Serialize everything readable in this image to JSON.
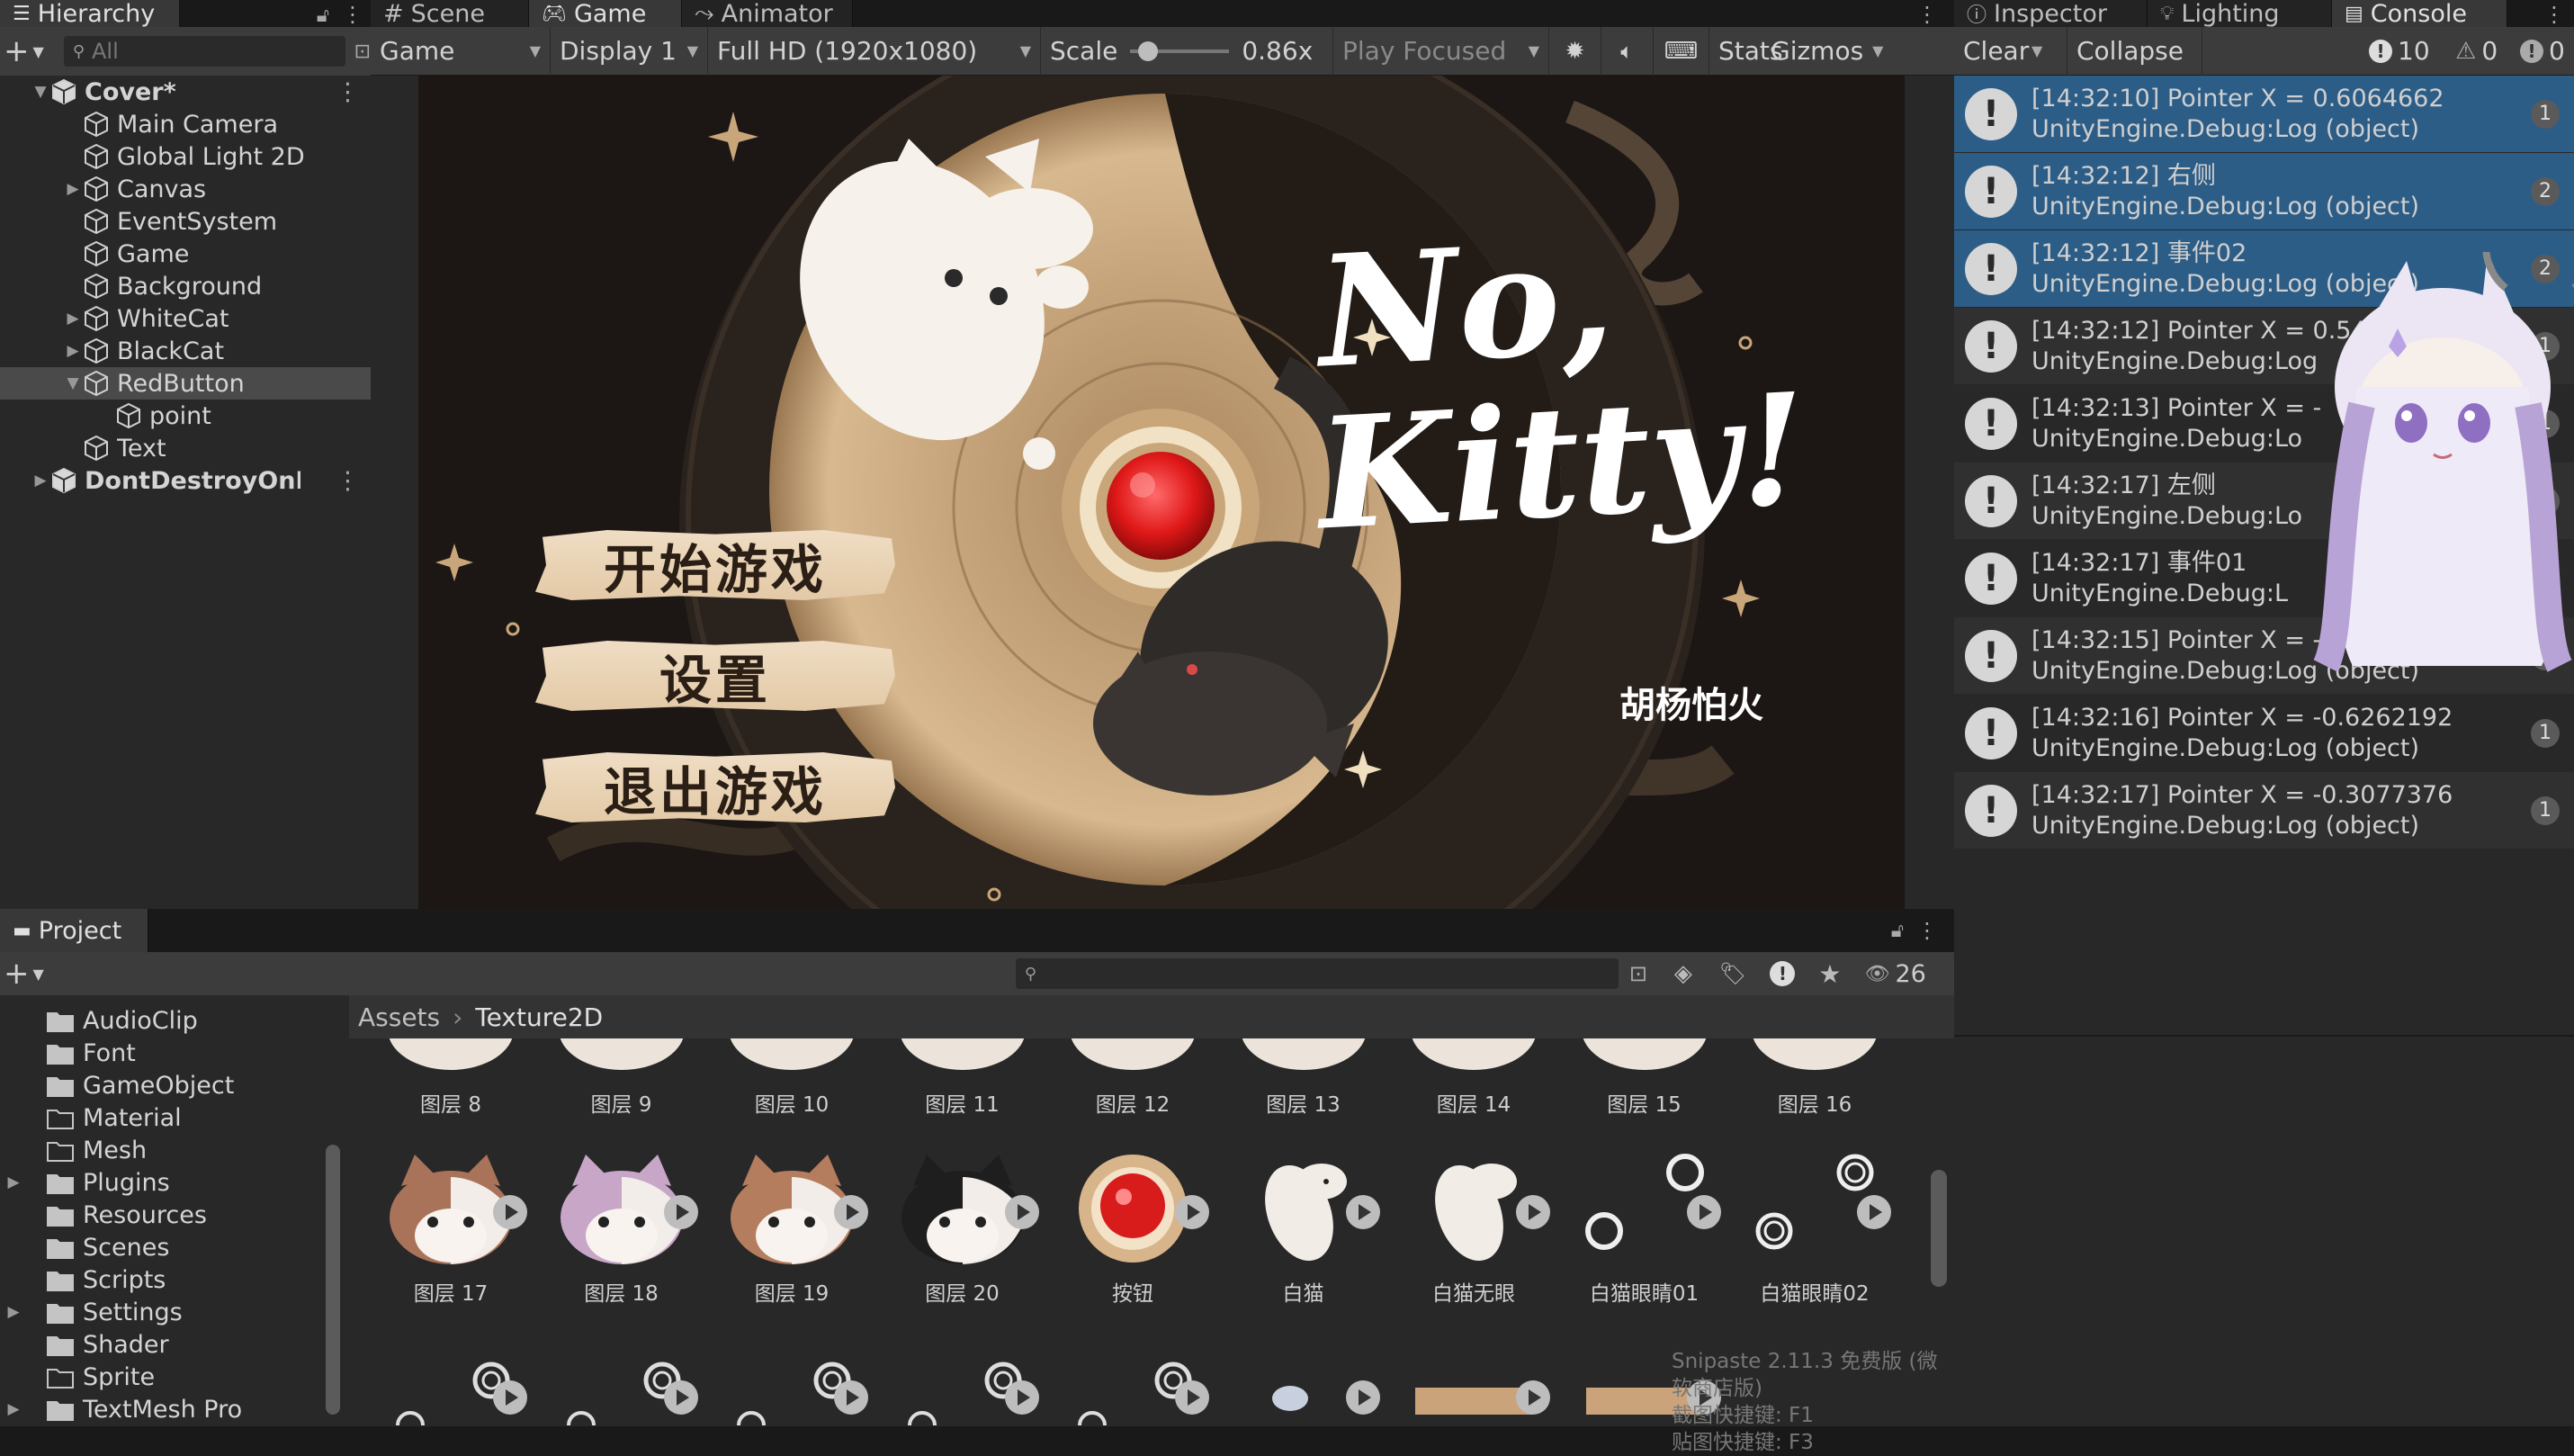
{
  "hierarchy": {
    "tab": "Hierarchy",
    "search_placeholder": "All",
    "items": [
      {
        "label": "Cover*",
        "depth": 0,
        "expanded": true,
        "scene": true
      },
      {
        "label": "Main Camera",
        "depth": 1
      },
      {
        "label": "Global Light 2D",
        "depth": 1
      },
      {
        "label": "Canvas",
        "depth": 1,
        "collapsed": true
      },
      {
        "label": "EventSystem",
        "depth": 1
      },
      {
        "label": "Game",
        "depth": 1
      },
      {
        "label": "Background",
        "depth": 1
      },
      {
        "label": "WhiteCat",
        "depth": 1,
        "collapsed": true
      },
      {
        "label": "BlackCat",
        "depth": 1,
        "collapsed": true
      },
      {
        "label": "RedButton",
        "depth": 1,
        "expanded": true,
        "selected": true
      },
      {
        "label": "point",
        "depth": 2
      },
      {
        "label": "Text",
        "depth": 1
      },
      {
        "label": "DontDestroyOnLoad",
        "depth": 0,
        "collapsed": true,
        "scene": true
      }
    ]
  },
  "center_tabs": {
    "scene": "Scene",
    "game": "Game",
    "animator": "Animator"
  },
  "game_toolbar": {
    "mode": "Game",
    "display": "Display 1",
    "resolution": "Full HD (1920x1080)",
    "scale_label": "Scale",
    "scale_value": "0.86x",
    "play_focused": "Play Focused",
    "stats": "Stats",
    "gizmos": "Gizmos",
    "scale_fraction": 0.1
  },
  "game_screen": {
    "title_line1": "No,",
    "title_line2": "Kitty!",
    "author": "胡杨怕火",
    "buttons": [
      "开始游戏",
      "设置",
      "退出游戏"
    ]
  },
  "right_tabs": {
    "inspector": "Inspector",
    "lighting": "Lighting",
    "console": "Console"
  },
  "console": {
    "clear": "Clear",
    "collapse": "Collapse",
    "counts": {
      "log": "10",
      "warn": "0",
      "error": "0"
    },
    "entries": [
      {
        "line1": "[14:32:10] Pointer X = 0.6064662",
        "line2": "UnityEngine.Debug:Log (object)",
        "count": "1",
        "selected": true
      },
      {
        "line1": "[14:32:12] 右侧",
        "line2": "UnityEngine.Debug:Log (object)",
        "count": "2",
        "selected": true
      },
      {
        "line1": "[14:32:12] 事件02",
        "line2": "UnityEngine.Debug:Log (object)",
        "count": "2",
        "selected": true
      },
      {
        "line1": "[14:32:12] Pointer X = 0.54",
        "line2": "UnityEngine.Debug:Log",
        "count": "1"
      },
      {
        "line1": "[14:32:13] Pointer X = -",
        "line2": "UnityEngine.Debug:Lo",
        "count": "1"
      },
      {
        "line1": "[14:32:17] 左侧",
        "line2": "UnityEngine.Debug:Lo",
        "count": "1"
      },
      {
        "line1": "[14:32:17] 事件01",
        "line2": "UnityEngine.Debug:L",
        "count": "1"
      },
      {
        "line1": "[14:32:15] Pointer X = -0.60",
        "line2": "UnityEngine.Debug:Log (object)",
        "count": "1"
      },
      {
        "line1": "[14:32:16] Pointer X = -0.6262192",
        "line2": "UnityEngine.Debug:Log (object)",
        "count": "1"
      },
      {
        "line1": "[14:32:17] Pointer X = -0.3077376",
        "line2": "UnityEngine.Debug:Log (object)",
        "count": "1"
      }
    ]
  },
  "project": {
    "tab": "Project",
    "hidden_count": "26",
    "breadcrumb": [
      "Assets",
      "Texture2D"
    ],
    "folders": [
      {
        "label": "AudioClip",
        "filled": true
      },
      {
        "label": "Font",
        "filled": true
      },
      {
        "label": "GameObject",
        "filled": true
      },
      {
        "label": "Material",
        "filled": false
      },
      {
        "label": "Mesh",
        "filled": false
      },
      {
        "label": "Plugins",
        "filled": true,
        "collapsed": true
      },
      {
        "label": "Resources",
        "filled": true
      },
      {
        "label": "Scenes",
        "filled": true
      },
      {
        "label": "Scripts",
        "filled": true
      },
      {
        "label": "Settings",
        "filled": true,
        "collapsed": true
      },
      {
        "label": "Shader",
        "filled": true
      },
      {
        "label": "Sprite",
        "filled": false
      },
      {
        "label": "TextMesh Pro",
        "filled": true,
        "collapsed": true
      }
    ],
    "row1": [
      "图层 8",
      "图层 9",
      "图层 10",
      "图层 11",
      "图层 12",
      "图层 13",
      "图层 14",
      "图层 15",
      "图层 16"
    ],
    "row2": [
      "图层 17",
      "图层 18",
      "图层 19",
      "图层 20",
      "按钮",
      "白猫",
      "白猫无眼",
      "白猫眼睛01",
      "白猫眼睛02"
    ]
  },
  "watermark": {
    "line1": "Snipaste 2.11.3 免费版 (微软商店版)",
    "line2": "截图快捷键: F1",
    "line3": "贴图快捷键: F3"
  },
  "colors": {
    "selection": "#2c5d87",
    "accent_red": "#e02525",
    "panel": "#282828"
  }
}
